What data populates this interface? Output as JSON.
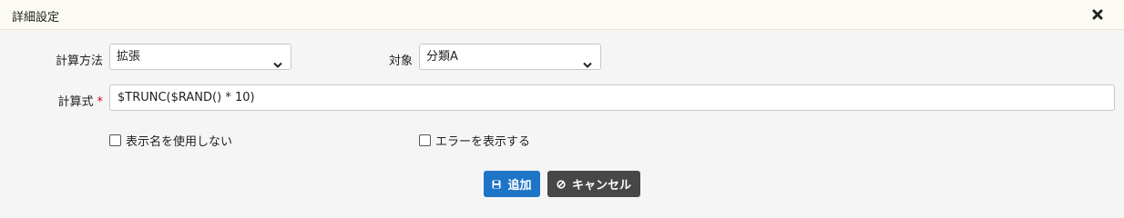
{
  "dialog": {
    "title": "詳細設定",
    "close_icon": "close-icon"
  },
  "form": {
    "calc_method": {
      "label": "計算方法",
      "value": "拡張"
    },
    "target": {
      "label": "対象",
      "value": "分類A"
    },
    "formula": {
      "label": "計算式",
      "required_mark": "*",
      "value": "$TRUNC($RAND() * 10)"
    },
    "hide_display_name": {
      "label": "表示名を使用しない",
      "checked": false
    },
    "show_error": {
      "label": "エラーを表示する",
      "checked": false
    }
  },
  "buttons": {
    "add": {
      "label": "追加",
      "icon": "save-icon",
      "color": "#1e74c6"
    },
    "cancel": {
      "label": "キャンセル",
      "icon": "ban-icon",
      "color": "#474747"
    }
  }
}
